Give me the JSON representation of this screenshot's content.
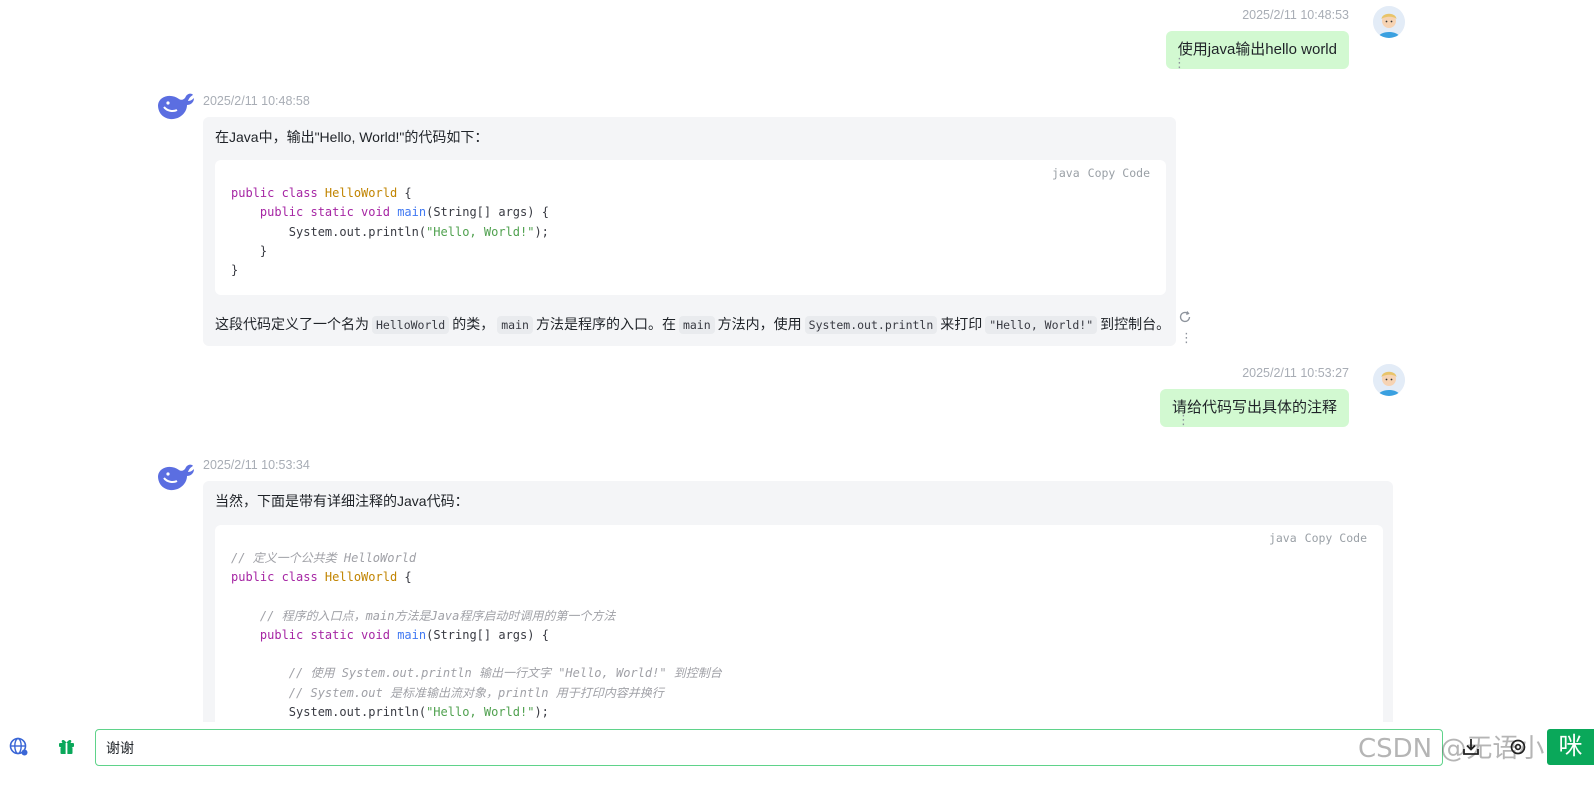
{
  "messages": [
    {
      "role": "user",
      "time": "2025/2/11 10:48:53",
      "text": "使用java输出hello world"
    },
    {
      "role": "assistant",
      "time": "2025/2/11 10:48:58",
      "intro": "在Java中，输出\"Hello, World!\"的代码如下：",
      "code": {
        "lang": "java",
        "copy_label": "Copy",
        "code_label": "Code",
        "lines": [
          "public class HelloWorld {",
          "    public static void main(String[] args) {",
          "        System.out.println(\"Hello, World!\");",
          "    }",
          "}"
        ]
      },
      "explanation": {
        "t1": "这段代码定义了一个名为",
        "c1": "HelloWorld",
        "t2": "的类，",
        "c2": "main",
        "t3": "方法是程序的入口。在",
        "c3": "main",
        "t4": "方法内，使用",
        "c4": "System.out.println",
        "t5": "来打印",
        "c5": "\"Hello, World!\"",
        "t6": "到控制台。"
      }
    },
    {
      "role": "user",
      "time": "2025/2/11 10:53:27",
      "text": "请给代码写出具体的注释"
    },
    {
      "role": "assistant",
      "time": "2025/2/11 10:53:34",
      "intro": "当然，下面是带有详细注释的Java代码：",
      "code": {
        "lang": "java",
        "copy_label": "Copy",
        "code_label": "Code",
        "lines": [
          "// 定义一个公共类 HelloWorld",
          "public class HelloWorld {",
          "",
          "    // 程序的入口点，main方法是Java程序启动时调用的第一个方法",
          "    public static void main(String[] args) {",
          "",
          "        // 使用 System.out.println 输出一行文字 \"Hello, World!\" 到控制台",
          "        // System.out 是标准输出流对象，println 用于打印内容并换行",
          "        System.out.println(\"Hello, World!\");"
        ]
      }
    }
  ],
  "input": {
    "value": "谢谢"
  },
  "watermark": "CSDN @无语小",
  "send_label": "咪",
  "icons": {
    "left_1": "globe-icon",
    "left_2": "gift-icon",
    "right_1": "download-icon",
    "right_2": "settings-icon"
  },
  "colors": {
    "user_bubble": "#d2f9d1",
    "bot_bubble": "#f4f5f7",
    "accent_green": "#0aa85a",
    "input_border": "#5fd38a"
  }
}
